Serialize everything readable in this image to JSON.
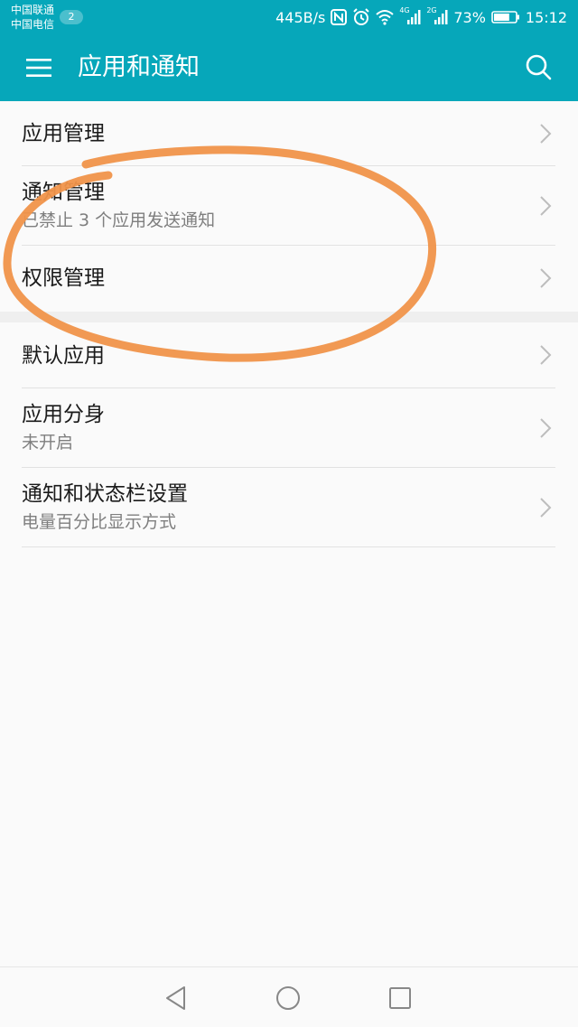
{
  "status_bar": {
    "carrier_1": "中国联通",
    "carrier_2": "中国电信",
    "carrier_badge": "2",
    "network_speed": "445B/s",
    "nfc_icon": "nfc-icon",
    "alarm_icon": "alarm-icon",
    "wifi_icon": "wifi-icon",
    "signal_1_label": "4G",
    "signal_2_label": "2G",
    "battery_percent": "73%",
    "battery_level": 0.73,
    "time": "15:12"
  },
  "toolbar": {
    "title": "应用和通知",
    "menu_icon": "menu-icon",
    "search_icon": "search-icon"
  },
  "group_1": [
    {
      "title": "应用管理",
      "subtitle": ""
    },
    {
      "title": "通知管理",
      "subtitle": "已禁止 3 个应用发送通知"
    },
    {
      "title": "权限管理",
      "subtitle": ""
    }
  ],
  "group_2": [
    {
      "title": "默认应用",
      "subtitle": ""
    },
    {
      "title": "应用分身",
      "subtitle": "未开启"
    },
    {
      "title": "通知和状态栏设置",
      "subtitle": "电量百分比显示方式"
    }
  ],
  "nav": {
    "back_icon": "back-triangle-icon",
    "home_icon": "home-circle-icon",
    "recents_icon": "recents-square-icon"
  },
  "colors": {
    "accent": "#06a7ba",
    "annotation": "#f0944a"
  }
}
